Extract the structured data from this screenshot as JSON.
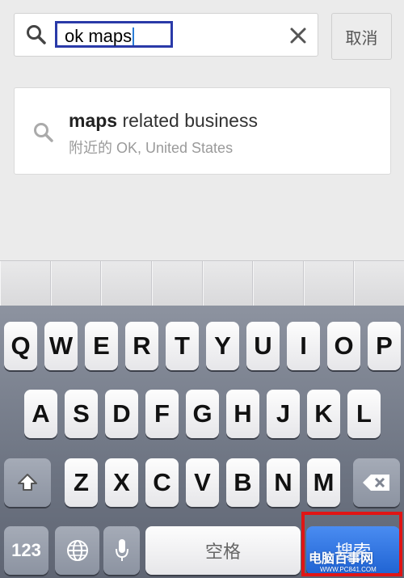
{
  "search": {
    "query": "ok maps",
    "cancel_label": "取消"
  },
  "suggestion": {
    "title_bold": "maps",
    "title_rest": " related business",
    "subtitle": "附近的 OK, United States"
  },
  "keyboard": {
    "row1": [
      "Q",
      "W",
      "E",
      "R",
      "T",
      "Y",
      "U",
      "I",
      "O",
      "P"
    ],
    "row2": [
      "A",
      "S",
      "D",
      "F",
      "G",
      "H",
      "J",
      "K",
      "L"
    ],
    "row3": [
      "Z",
      "X",
      "C",
      "V",
      "B",
      "N",
      "M"
    ],
    "numbers_label": "123",
    "space_label": "空格",
    "search_label": "搜索"
  },
  "watermark": {
    "main": "电脑百事网",
    "sub": "WWW.PC841.COM"
  },
  "colors": {
    "highlight_box": "#2a3aa8",
    "red_outline": "#e01515",
    "search_key": "#1f63d3"
  }
}
